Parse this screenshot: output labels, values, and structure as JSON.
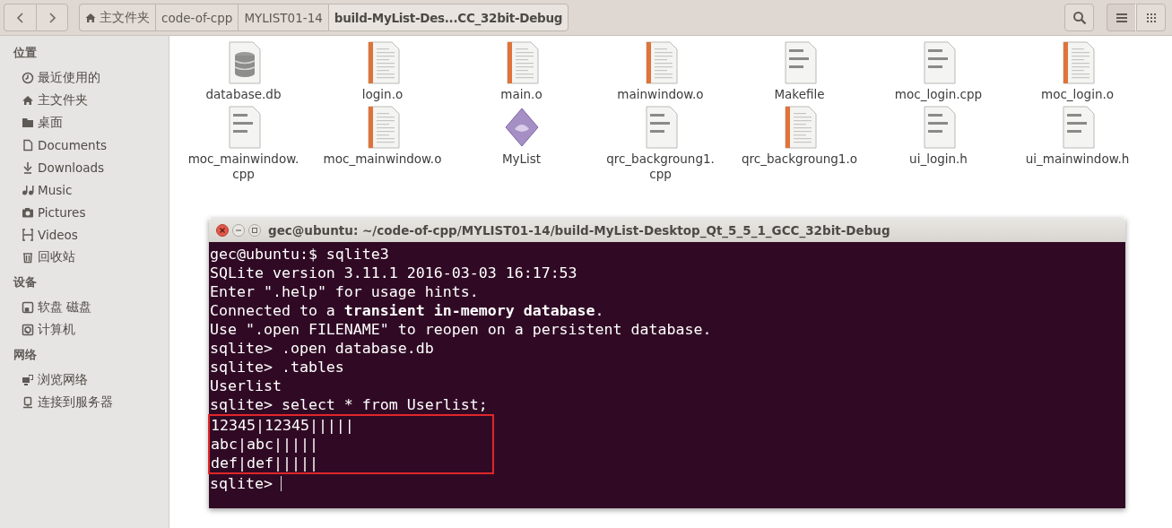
{
  "toolbar": {
    "nav": [
      {
        "kind": "back"
      },
      {
        "kind": "forward"
      }
    ],
    "path": [
      {
        "label": "主文件夹",
        "kind": "home",
        "selected": false
      },
      {
        "label": "code-of-cpp",
        "kind": "folder",
        "selected": false
      },
      {
        "label": "MYLIST01-14",
        "kind": "folder",
        "selected": false
      },
      {
        "label": "build-MyList-Des...CC_32bit-Debug",
        "kind": "folder",
        "selected": true
      }
    ],
    "view_buttons": [
      {
        "kind": "list",
        "selected": true
      },
      {
        "kind": "grid",
        "selected": false
      }
    ]
  },
  "sidebar": {
    "sections": [
      {
        "heading": "位置",
        "items": [
          {
            "label": "最近使用的",
            "kind": "recent"
          },
          {
            "label": "主文件夹",
            "kind": "home"
          },
          {
            "label": "桌面",
            "kind": "folder"
          },
          {
            "label": "Documents",
            "kind": "document"
          },
          {
            "label": "Downloads",
            "kind": "download"
          },
          {
            "label": "Music",
            "kind": "music"
          },
          {
            "label": "Pictures",
            "kind": "camera"
          },
          {
            "label": "Videos",
            "kind": "film"
          },
          {
            "label": "回收站",
            "kind": "trash"
          }
        ]
      },
      {
        "heading": "设备",
        "items": [
          {
            "label": "软盘 磁盘",
            "kind": "drive"
          },
          {
            "label": "计算机",
            "kind": "computer"
          }
        ]
      },
      {
        "heading": "网络",
        "items": [
          {
            "label": "浏览网络",
            "kind": "network"
          },
          {
            "label": "连接到服务器",
            "kind": "server"
          }
        ]
      }
    ]
  },
  "files": [
    {
      "name": "database.db",
      "kind": "database"
    },
    {
      "name": "login.o",
      "kind": "object"
    },
    {
      "name": "main.o",
      "kind": "object"
    },
    {
      "name": "mainwindow.o",
      "kind": "object"
    },
    {
      "name": "Makefile",
      "kind": "text"
    },
    {
      "name": "moc_login.cpp",
      "kind": "text"
    },
    {
      "name": "moc_login.o",
      "kind": "object"
    },
    {
      "name": "moc_mainwindow.\ncpp",
      "kind": "text"
    },
    {
      "name": "moc_mainwindow.o",
      "kind": "object"
    },
    {
      "name": "MyList",
      "kind": "app"
    },
    {
      "name": "qrc_backgroung1.\ncpp",
      "kind": "text"
    },
    {
      "name": "qrc_backgroung1.o",
      "kind": "object"
    },
    {
      "name": "ui_login.h",
      "kind": "text"
    },
    {
      "name": "ui_mainwindow.h",
      "kind": "text"
    }
  ],
  "terminal": {
    "title": "gec@ubuntu: ~/code-of-cpp/MYLIST01-14/build-MyList-Desktop_Qt_5_5_1_GCC_32bit-Debug",
    "lines": [
      {
        "text": "gec@ubuntu:$ sqlite3",
        "highlighted": false
      },
      {
        "text": "SQLite version 3.11.1 2016-03-03 16:17:53",
        "highlighted": false
      },
      {
        "text": "Enter \".help\" for usage hints.",
        "highlighted": false
      },
      {
        "text": "Connected to a **transient in-memory database**.",
        "highlighted": false
      },
      {
        "text": "Use \".open FILENAME\" to reopen on a persistent database.",
        "highlighted": false
      },
      {
        "text": "sqlite> .open database.db",
        "highlighted": false
      },
      {
        "text": "sqlite> .tables",
        "highlighted": false
      },
      {
        "text": "Userlist",
        "highlighted": false
      },
      {
        "text": "sqlite> select * from Userlist;",
        "highlighted": false
      },
      {
        "text": "12345|12345|||||",
        "highlighted": true
      },
      {
        "text": "abc|abc|||||",
        "highlighted": true
      },
      {
        "text": "def|def|||||",
        "highlighted": true
      },
      {
        "text": "sqlite>",
        "highlighted": false
      }
    ]
  }
}
